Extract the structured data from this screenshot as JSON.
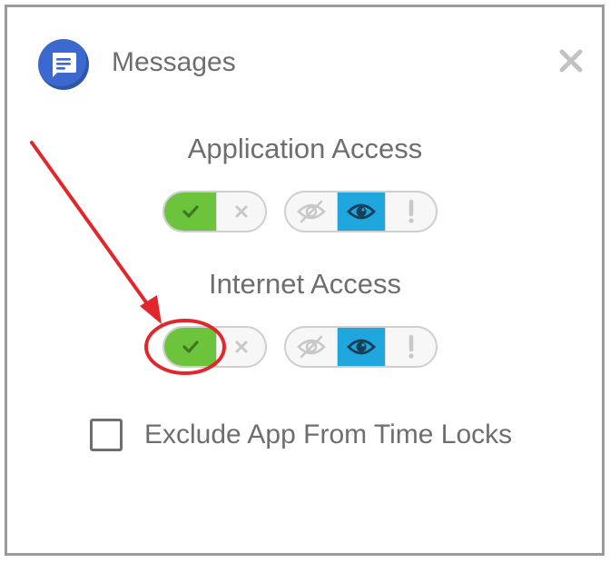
{
  "app": {
    "name": "Messages",
    "icon": "messages-app-icon"
  },
  "dialog": {
    "close_icon": "close-icon"
  },
  "sections": [
    {
      "title": "Application Access",
      "allow_toggle": {
        "state": "allow",
        "options": [
          "check-icon",
          "x-icon"
        ]
      },
      "visibility_toggle": {
        "state": "visible",
        "options": [
          "eye-slash-icon",
          "eye-icon",
          "exclamation-icon"
        ]
      }
    },
    {
      "title": "Internet Access",
      "allow_toggle": {
        "state": "allow",
        "options": [
          "check-icon",
          "x-icon"
        ]
      },
      "visibility_toggle": {
        "state": "visible",
        "options": [
          "eye-slash-icon",
          "eye-icon",
          "exclamation-icon"
        ]
      }
    }
  ],
  "time_locks": {
    "label": "Exclude App From Time Locks",
    "checked": false
  },
  "colors": {
    "allow_green": "#6cc33c",
    "visible_blue": "#1fa6dc",
    "app_icon_blue": "#3b69cf",
    "annotation_red": "#e3262b"
  }
}
